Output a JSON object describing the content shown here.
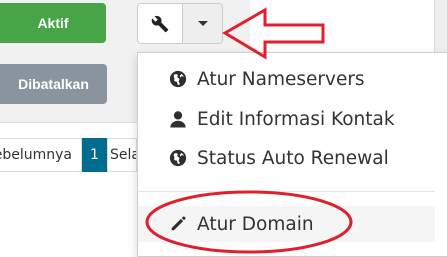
{
  "status_buttons": {
    "active_label": "Aktif",
    "cancelled_label": "Dibatalkan"
  },
  "actions": {
    "settings_icon": "wrench-icon",
    "toggle_icon": "caret-down-icon"
  },
  "dropdown": {
    "items": [
      {
        "label": "Atur Nameservers",
        "icon": "globe-icon"
      },
      {
        "label": "Edit Informasi Kontak",
        "icon": "user-icon"
      },
      {
        "label": "Status Auto Renewal",
        "icon": "globe-icon"
      },
      {
        "label": "Atur Domain",
        "icon": "pencil-icon"
      }
    ]
  },
  "pagination": {
    "prev_label": "Sebelumnya",
    "current_page": "1",
    "next_label": "Selanjutnya"
  },
  "colors": {
    "active": "#47a447",
    "cancelled": "#8a949e",
    "page_active": "#006c8f",
    "annotation": "#e0202a"
  }
}
